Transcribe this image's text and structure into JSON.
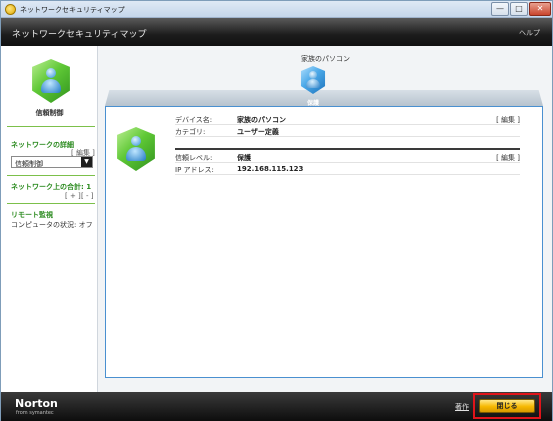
{
  "window": {
    "title": "ネットワークセキュリティマップ",
    "min_glyph": "—",
    "max_glyph": "□",
    "close_glyph": "✕"
  },
  "header": {
    "title": "ネットワークセキュリティマップ",
    "help": "ヘルプ"
  },
  "sidebar": {
    "device_caption": "信頼制御",
    "network_details_heading": "ネットワークの詳細",
    "edit_link": "[ 編集 ]",
    "trust_dropdown_value": "信頼制御",
    "devices_on_network_label": "ネットワーク上の合計: 1",
    "expand_link": "[ + ]",
    "collapse_link": "[ - ]",
    "remote_monitoring_heading": "リモート監視",
    "computer_status": "コンピュータの状況: オフ"
  },
  "map": {
    "network_label": "家族のパソコン",
    "top_shield_label": "保護"
  },
  "details": {
    "group1": [
      {
        "key": "デバイス名:",
        "value": "家族のパソコン",
        "edit": "[ 編集 ]"
      },
      {
        "key": "カテゴリ:",
        "value": "ユーザー定義",
        "edit": ""
      }
    ],
    "group2": [
      {
        "key": "信頼レベル:",
        "value": "保護",
        "edit": "[ 編集 ]"
      },
      {
        "key": "IP アドレス:",
        "value": "192.168.115.123",
        "edit": ""
      }
    ]
  },
  "footer": {
    "logo": "Norton",
    "logo_sub": "from symantec",
    "link": "著作",
    "close_button": "閉じる"
  },
  "colors": {
    "accent_green": "#2a8a1e",
    "panel_border": "#4a90d0",
    "highlight": "#e0141a",
    "button_yellow": "#f6b800"
  }
}
